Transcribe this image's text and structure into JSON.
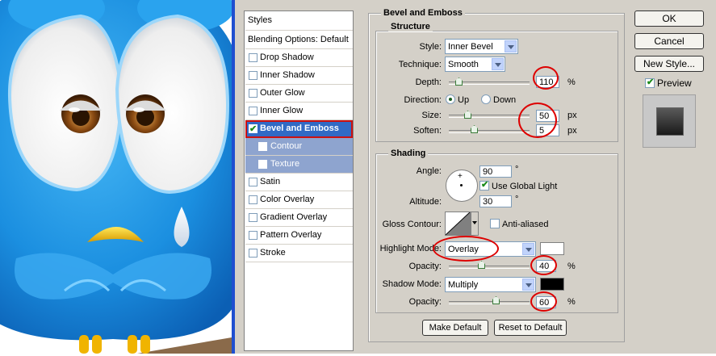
{
  "styles_panel": {
    "title": "Styles",
    "items": [
      {
        "label": "Blending Options: Default"
      },
      {
        "label": "Drop Shadow",
        "checked": false
      },
      {
        "label": "Inner Shadow",
        "checked": false
      },
      {
        "label": "Outer Glow",
        "checked": false
      },
      {
        "label": "Inner Glow",
        "checked": false
      },
      {
        "label": "Bevel and Emboss",
        "checked": true,
        "active": true
      },
      {
        "label": "Contour",
        "checked": false,
        "sub": true
      },
      {
        "label": "Texture",
        "checked": false,
        "sub": true
      },
      {
        "label": "Satin",
        "checked": false
      },
      {
        "label": "Color Overlay",
        "checked": false
      },
      {
        "label": "Gradient Overlay",
        "checked": false
      },
      {
        "label": "Pattern Overlay",
        "checked": false
      },
      {
        "label": "Stroke",
        "checked": false
      }
    ]
  },
  "bevel": {
    "title": "Bevel and Emboss",
    "structure": {
      "title": "Structure",
      "style_label": "Style:",
      "style_value": "Inner Bevel",
      "technique_label": "Technique:",
      "technique_value": "Smooth",
      "depth_label": "Depth:",
      "depth_value": "110",
      "depth_unit": "%",
      "direction_label": "Direction:",
      "direction_up": "Up",
      "direction_down": "Down",
      "size_label": "Size:",
      "size_value": "50",
      "size_unit": "px",
      "soften_label": "Soften:",
      "soften_value": "5",
      "soften_unit": "px"
    },
    "shading": {
      "title": "Shading",
      "angle_label": "Angle:",
      "angle_value": "90",
      "degree": "°",
      "global_light_label": "Use Global Light",
      "altitude_label": "Altitude:",
      "altitude_value": "30",
      "gloss_label": "Gloss Contour:",
      "anti_aliased_label": "Anti-aliased",
      "highlight_label": "Highlight Mode:",
      "highlight_value": "Overlay",
      "highlight_color": "#ffffff",
      "highlight_opacity_label": "Opacity:",
      "highlight_opacity": "40",
      "shadow_label": "Shadow Mode:",
      "shadow_value": "Multiply",
      "shadow_color": "#000000",
      "shadow_opacity_label": "Opacity:",
      "shadow_opacity": "60",
      "percent": "%"
    },
    "make_default": "Make Default",
    "reset_default": "Reset to Default"
  },
  "buttons": {
    "ok": "OK",
    "cancel": "Cancel",
    "new_style": "New Style...",
    "preview_label": "Preview"
  },
  "colors": {
    "dialog_bg": "#d4d0c8",
    "selection": "#316ac5",
    "sub_selection": "#8ea4cf",
    "annotation_red": "#dd0000"
  }
}
